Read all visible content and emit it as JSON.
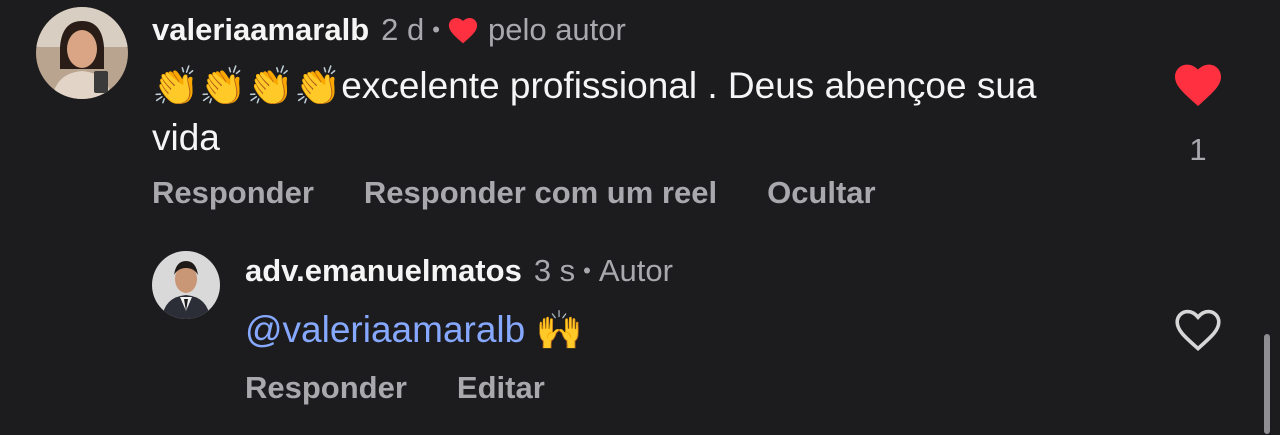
{
  "comments": [
    {
      "username": "valeriaamaralb",
      "time": "2 d",
      "liked_by_author_label": "pelo autor",
      "emoji": "👏👏👏👏",
      "text": "excelente profissional . Deus abençoe sua vida",
      "like_count": "1",
      "liked": true,
      "actions": [
        "Responder",
        "Responder com um reel",
        "Ocultar"
      ]
    },
    {
      "username": "adv.emanuelmatos",
      "time": "3 s",
      "author_label": "Autor",
      "mention": "@valeriaamaralb",
      "emoji": "🙌",
      "liked": false,
      "actions": [
        "Responder",
        "Editar"
      ]
    }
  ],
  "colors": {
    "background": "#1c1c1e",
    "heart": "#ff3040",
    "mention": "#86a8ff",
    "muted": "#a8a8ad"
  },
  "icons": [
    "heart-filled-icon",
    "heart-outline-icon"
  ]
}
